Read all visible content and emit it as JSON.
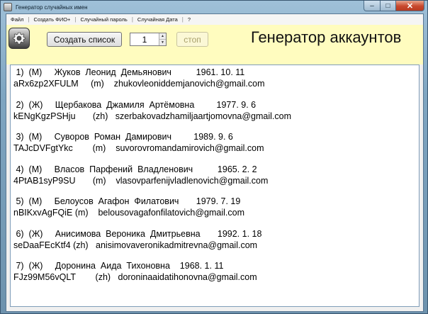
{
  "window": {
    "title": "Генератор случайных имен",
    "controls": {
      "minimize": "–",
      "maximize": "□",
      "close": "✕"
    }
  },
  "menu": {
    "items": [
      "Файл",
      "Создать ФИО+",
      "Случайный пароль",
      "Случайная Дата",
      "?"
    ],
    "separator": "|"
  },
  "toolbar": {
    "gear_icon": "gear-icon",
    "create_label": "Создать список",
    "count_value": "1",
    "stop_label": "стоп",
    "heading": "Генератор аккаунтов"
  },
  "records": [
    {
      "line1": " 1)  (М)     Жуков  Леонид  Демьянович          1961. 10. 11",
      "line2": "aRx6zp2XFULM     (m)    zhukovleoniddemjanovich@gmail.com"
    },
    {
      "line1": " 2)  (Ж)     Щербакова  Джамиля  Артёмовна         1977. 9. 6",
      "line2": "kENgKgzPSHju       (zh)   szerbakovadzhamiljaartjomovna@gmail.com"
    },
    {
      "line1": " 3)  (М)     Суворов  Роман  Дамирович         1989. 9. 6",
      "line2": "TAJcDVFgtYkc        (m)    suvorovromandamirovich@gmail.com"
    },
    {
      "line1": " 4)  (М)     Власов  Парфений  Владленович          1965. 2. 2",
      "line2": "4PtAB1syP9SU       (m)    vlasovparfenijvladlenovich@gmail.com"
    },
    {
      "line1": " 5)  (М)     Белоусов  Агафон  Филатович       1979. 7. 19",
      "line2": "nBIKxvAgFQiE (m)    belousovagafonfilatovich@gmail.com"
    },
    {
      "line1": " 6)  (Ж)     Анисимова  Вероника  Дмитрьевна       1992. 1. 18",
      "line2": "seDaaFEcKtf4 (zh)   anisimovaveronikadmitrevna@gmail.com"
    },
    {
      "line1": " 7)  (Ж)     Доронина  Аида  Тихоновна    1968. 1. 11",
      "line2": "FJz99M56vQLT        (zh)   doroninaaidatihonovna@gmail.com"
    }
  ]
}
